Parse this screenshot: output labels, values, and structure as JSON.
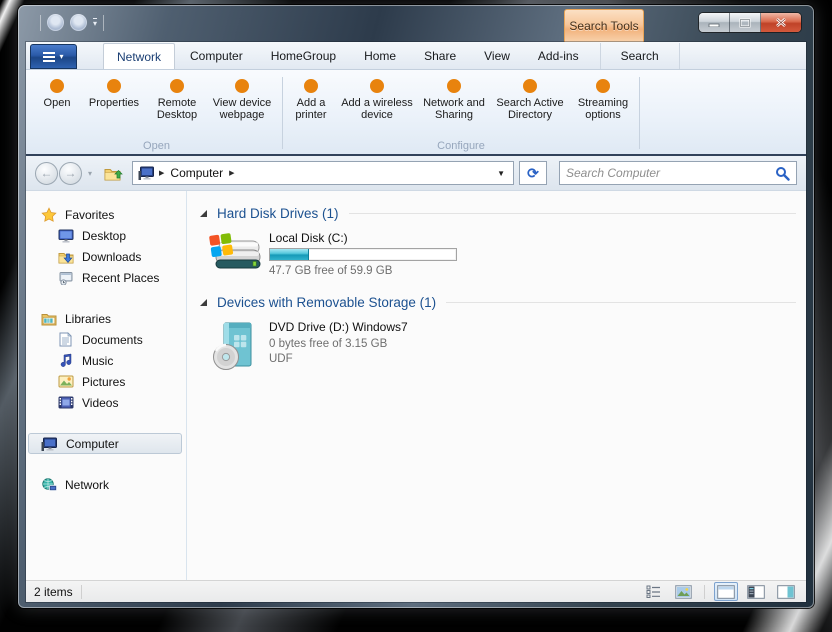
{
  "colors": {
    "ribbon_icon_orange": "#e8830e",
    "contextual_tab_peach": "#f6c496",
    "capacity_bar_teal": "#2fb2cd",
    "close_button_red": "#c64530",
    "group_header_blue": "#1c5190",
    "file_menu_blue": "#2a5aa8"
  },
  "titlebar": {
    "contextual_tab_label": "Search Tools"
  },
  "tabs": {
    "active": "Network",
    "labels": [
      "Network",
      "Computer",
      "HomeGroup",
      "Home",
      "Share",
      "View",
      "Add-ins",
      "Search"
    ]
  },
  "ribbon": {
    "groups": [
      {
        "label": "Open",
        "buttons": [
          {
            "label": "Open"
          },
          {
            "label": "Properties"
          },
          {
            "label": "Remote Desktop"
          },
          {
            "label": "View device webpage"
          }
        ]
      },
      {
        "label": "Configure",
        "buttons": [
          {
            "label": "Add a printer"
          },
          {
            "label": "Add a wireless device"
          },
          {
            "label": "Network and Sharing"
          },
          {
            "label": "Search Active Directory"
          },
          {
            "label": "Streaming options"
          }
        ]
      }
    ]
  },
  "address": {
    "breadcrumb_root": "Computer",
    "search_placeholder": "Search Computer"
  },
  "sidebar": {
    "selected": "Computer",
    "sections": [
      {
        "label": "Favorites",
        "children": [
          "Desktop",
          "Downloads",
          "Recent Places"
        ]
      },
      {
        "label": "Libraries",
        "children": [
          "Documents",
          "Music",
          "Pictures",
          "Videos"
        ]
      },
      {
        "label": "Computer",
        "children": []
      },
      {
        "label": "Network",
        "children": []
      }
    ]
  },
  "content": {
    "groups": [
      {
        "header": "Hard Disk Drives (1)",
        "items": [
          {
            "name": "Local Disk (C:)",
            "capacity_text": "47.7 GB free of 59.9 GB",
            "used_percent": 21
          }
        ]
      },
      {
        "header": "Devices with Removable Storage (1)",
        "items": [
          {
            "name": "DVD Drive (D:) Windows7",
            "capacity_text": "0 bytes free of 3.15 GB",
            "filesystem": "UDF"
          }
        ]
      }
    ]
  },
  "statusbar": {
    "items_text": "2 items"
  },
  "glyphs": {
    "crumb_sep": "▶",
    "dropdown": "▼",
    "nav_dropdown": "▾",
    "back_arrow": "←",
    "forward_arrow": "→",
    "refresh": "⟳",
    "file_caret": "▼"
  }
}
